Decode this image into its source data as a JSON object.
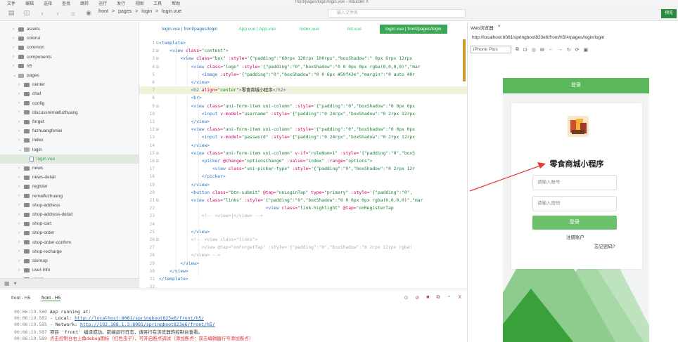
{
  "menubar": {
    "items": [
      "文件",
      "编辑",
      "选择",
      "查找",
      "跳转",
      "运行",
      "发行",
      "视图",
      "工具",
      "帮助"
    ],
    "window_title": "front/pages/login/login.vue - HBuilder X"
  },
  "toolbar": {
    "crumbs": [
      "front",
      ">",
      "pages",
      ">",
      "login",
      ">",
      "login.vue"
    ],
    "search_placeholder": "输入文件名",
    "preview_label": "预览"
  },
  "tree": {
    "items": [
      {
        "label": "assets",
        "type": "folder",
        "level": 1
      },
      {
        "label": "colorui",
        "type": "folder",
        "level": 1
      },
      {
        "label": "common",
        "type": "folder",
        "level": 1
      },
      {
        "label": "components",
        "type": "folder",
        "level": 1
      },
      {
        "label": "h5",
        "type": "folder",
        "level": 1
      },
      {
        "label": "pages",
        "type": "folder-open",
        "level": 1
      },
      {
        "label": "center",
        "type": "folder",
        "level": 2
      },
      {
        "label": "chat",
        "type": "folder",
        "level": 2
      },
      {
        "label": "config",
        "type": "folder",
        "level": 2
      },
      {
        "label": "discussremaifuzhuang",
        "type": "folder",
        "level": 2
      },
      {
        "label": "forget",
        "type": "folder",
        "level": 2
      },
      {
        "label": "fuzhuangfenlei",
        "type": "folder",
        "level": 2
      },
      {
        "label": "index",
        "type": "folder",
        "level": 2
      },
      {
        "label": "login",
        "type": "folder-open",
        "level": 2
      },
      {
        "label": "login.vue",
        "type": "file",
        "level": 3,
        "selected": true
      },
      {
        "label": "news",
        "type": "folder",
        "level": 2
      },
      {
        "label": "news-detail",
        "type": "folder",
        "level": 2
      },
      {
        "label": "register",
        "type": "folder",
        "level": 2
      },
      {
        "label": "remaifuzhuang",
        "type": "folder",
        "level": 2
      },
      {
        "label": "shop-address",
        "type": "folder",
        "level": 2
      },
      {
        "label": "shop-address-detail",
        "type": "folder",
        "level": 2
      },
      {
        "label": "shop-cart",
        "type": "folder",
        "level": 2
      },
      {
        "label": "shop-order",
        "type": "folder",
        "level": 2
      },
      {
        "label": "shop-order-confirm",
        "type": "folder",
        "level": 2
      },
      {
        "label": "shop-recharge",
        "type": "folder",
        "level": 2
      },
      {
        "label": "storeup",
        "type": "folder",
        "level": 2
      },
      {
        "label": "user-info",
        "type": "folder",
        "level": 2
      },
      {
        "label": "users",
        "type": "folder",
        "level": 2
      }
    ]
  },
  "editor": {
    "tabs": [
      {
        "label": "login.vue | front/pages/login",
        "active": false
      },
      {
        "label": "App.vue | App.vue",
        "active": false
      },
      {
        "label": "index.vue",
        "active": false
      },
      {
        "label": "list.vue",
        "active": false
      },
      {
        "label": "login.vue | front/pages/login",
        "active": true
      }
    ],
    "lines": [
      {
        "n": "1",
        "fold": "⊟",
        "html": "<span class='tag'>&lt;template&gt;</span>"
      },
      {
        "n": "2",
        "fold": "⊟",
        "html": "    <span class='tag'>&lt;view</span> <span class='attr'>class=</span><span class='str'>\"content\"</span><span class='tag'>&gt;</span>"
      },
      {
        "n": "3",
        "fold": "⊟",
        "html": "        <span class='tag'>&lt;view</span> <span class='attr'>class=</span><span class='str'>\"box\"</span> <span class='attr'>:style=</span><span class='str'>'{\"padding\":\"60rpx 120rpx 100rpx\",\"boxShadow\":\" 0px 6rpx 12rpx</span>"
      },
      {
        "n": "4",
        "fold": "⊟",
        "html": "            <span class='tag'>&lt;view</span> <span class='attr'>class=</span><span class='str'>\"logo\"</span> <span class='attr'>:style=</span><span class='str'>'{\"padding\":\"0\",\"boxShadow\":\"0 0 0px 0px rgba(0,0,0,0)\",\"mar</span>"
      },
      {
        "n": "5",
        "fold": "",
        "html": "                <span class='tag'>&lt;image</span> <span class='attr'>:style=</span><span class='str'>'{\"padding\":\"0\",\"boxShadow\":\"0 0 6px #59f43e\",\"margin\":\"0 auto 40r</span>"
      },
      {
        "n": "6",
        "fold": "",
        "html": "            <span class='tag'>&lt;/view&gt;</span>"
      },
      {
        "n": "7",
        "fold": "",
        "hl": true,
        "html": "            <span class='tag'>&lt;h2</span> <span class='attr'>align=</span><span class='str'>\"center\"</span><span class='tag'>&gt;</span><span class='txt'>零食商城小程序</span><span class='tag'>&lt;/h2&gt;</span>"
      },
      {
        "n": "8",
        "fold": "",
        "html": "            <span class='tag'>&lt;br&gt;</span>"
      },
      {
        "n": "9",
        "fold": "⊟",
        "html": "            <span class='tag'>&lt;view</span> <span class='attr'>class=</span><span class='str'>\"uni-form-item uni-column\"</span> <span class='attr'>:style=</span><span class='str'>'{\"padding\":\"0\",\"boxShadow\":\"0 0px 0px</span>"
      },
      {
        "n": "10",
        "fold": "",
        "html": "                <span class='tag'>&lt;input</span> <span class='attr'>v-model=</span><span class='str'>\"username\"</span> <span class='attr'>:style=</span><span class='str'>'{\"padding\":\"0 24rpx\",\"boxShadow\":\"0 2rpx 12rpx</span>"
      },
      {
        "n": "11",
        "fold": "",
        "html": "            <span class='tag'>&lt;/view&gt;</span>"
      },
      {
        "n": "12",
        "fold": "⊟",
        "html": "            <span class='tag'>&lt;view</span> <span class='attr'>class=</span><span class='str'>\"uni-form-item uni-column\"</span> <span class='attr'>:style=</span><span class='str'>'{\"padding\":\"0\",\"boxShadow\":\"0 0px 0px</span>"
      },
      {
        "n": "13",
        "fold": "",
        "html": "                <span class='tag'>&lt;input</span> <span class='attr'>v-model=</span><span class='str'>\"password\"</span> <span class='attr'>:style=</span><span class='str'>'{\"padding\":\"0 24rpx\",\"boxShadow\":\"0 2rpx 12rpx</span>"
      },
      {
        "n": "14",
        "fold": "",
        "html": "            <span class='tag'>&lt;/view&gt;</span>"
      },
      {
        "n": "15",
        "fold": "⊟",
        "html": "            <span class='tag'>&lt;view</span> <span class='attr'>class=</span><span class='str'>\"uni-form-item uni-column\"</span> <span class='attr'>v-if=</span><span class='str'>\"roleNum&gt;1\"</span> <span class='attr'>:style=</span><span class='str'>'{\"padding\":\"0\",\"boxS</span>"
      },
      {
        "n": "16",
        "fold": "⊟",
        "html": "                <span class='tag'>&lt;picker</span> <span class='attr'>@change=</span><span class='str'>\"optionsChange\"</span> <span class='attr'>:value=</span><span class='str'>\"index\"</span> <span class='attr'>:range=</span><span class='str'>\"options\"</span><span class='tag'>&gt;</span>"
      },
      {
        "n": "17",
        "fold": "",
        "html": "                    <span class='tag'>&lt;view</span> <span class='attr'>class=</span><span class='str'>\"uni-picker-type\"</span> <span class='attr'>:style=</span><span class='str'>'{\"padding\":\"0\",\"boxShadow\":\"0 2rpx 12r</span>"
      },
      {
        "n": "18",
        "fold": "",
        "html": "                <span class='tag'>&lt;/picker&gt;</span>"
      },
      {
        "n": "19",
        "fold": "",
        "html": "            <span class='tag'>&lt;/view&gt;</span>"
      },
      {
        "n": "20",
        "fold": "",
        "html": "            <span class='tag'>&lt;button</span> <span class='attr'>class=</span><span class='str'>\"btn-submit\"</span> <span class='attr'>@tap=</span><span class='str'>\"onLoginTap\"</span> <span class='attr'>type=</span><span class='str'>\"primary\"</span> <span class='attr'>:style=</span><span class='str'>'{\"padding\":\"0\",</span>"
      },
      {
        "n": "21",
        "fold": "⊟",
        "html": "            <span class='tag'>&lt;view</span> <span class='attr'>class=</span><span class='str'>\"links\"</span> <span class='attr'>:style=</span><span class='str'>'{\"padding\":\"0\",\"boxShadow\":\"0 0 0px 0px rgba(0,0,0,0)\",\"mar</span>"
      },
      {
        "n": "22",
        "fold": "",
        "html": "                                        <span class='tag'>&lt;view</span> <span class='attr'>class=</span><span class='str'>\"link-highlight\"</span> <span class='attr'>@tap=</span><span class='str'>\"onRegisterTap</span>"
      },
      {
        "n": "23",
        "fold": "",
        "html": "                <span class='cmt'>&lt;!-- &lt;view&gt;|&lt;/view&gt; --&gt;</span>"
      },
      {
        "n": "24",
        "fold": "",
        "html": ""
      },
      {
        "n": "25",
        "fold": "",
        "html": "            <span class='tag'>&lt;/view&gt;</span>"
      },
      {
        "n": "26",
        "fold": "⊟",
        "html": "            <span class='cmt'>&lt;!-- &lt;view class=\"links\"&gt;</span>"
      },
      {
        "n": "27",
        "fold": "",
        "html": "                <span class='cmt'>&lt;view @tap=\"onForgetTap\" :style='{\"padding\":\"0\",\"boxShadow\":\"0 2rpx 12rpx rgba(</span>"
      },
      {
        "n": "28",
        "fold": "",
        "html": "            <span class='cmt'>&lt;/view&gt; --&gt;</span>"
      },
      {
        "n": "29",
        "fold": "",
        "html": "        <span class='tag'>&lt;/view&gt;</span>"
      },
      {
        "n": "30",
        "fold": "",
        "html": "    <span class='tag'>&lt;/view&gt;</span>"
      },
      {
        "n": "31",
        "fold": "",
        "html": "<span class='tag'>&lt;/template&gt;</span>"
      },
      {
        "n": "32",
        "fold": "",
        "html": ""
      }
    ]
  },
  "console": {
    "tabs": [
      {
        "label": "front - H5",
        "active": false
      },
      {
        "label": "front - H5",
        "active": true
      }
    ],
    "icons": [
      "⊙",
      "⊘",
      "■",
      "⧉",
      "⌃",
      "X"
    ],
    "lines": [
      {
        "time": "00:06:19.580",
        "text": "  App running at:",
        "link": ""
      },
      {
        "time": "00:06:19.582",
        "text": "  - Local:   ",
        "link": "http://localhost:8081/springboot823e6/front/h5/"
      },
      {
        "time": "00:06:19.585",
        "text": "  - Network: ",
        "link": "http://192.168.1.3:8081/springboot823e6/front/h5/"
      },
      {
        "time": "00:06:19.587",
        "text": " 项目 'front' 编译成功。前端运行日志，请另行在浏览器的控制台查看。",
        "link": ""
      },
      {
        "time": "00:06:19.589",
        "text": " 点击控制台右上角debug图标（红色虫子），可开启断点调试（添加断点：双击编辑器行号添加断点）",
        "link": "",
        "red": true
      }
    ]
  },
  "browser": {
    "title": "Web浏览器",
    "close": "×",
    "url": "http://localhost:8081/springboot823e6/front/h5/#/pages/login/login",
    "device": "iPhone Plus",
    "tool_icons": [
      "⧉",
      "⊡",
      "◎",
      "⊞",
      "←",
      "→",
      "↻",
      "⟳",
      "▣"
    ],
    "app": {
      "nav_title": "登录",
      "title": "零食商城小程序",
      "username_placeholder": "请输入账号",
      "password_placeholder": "请输入密码",
      "login_label": "登录",
      "register_label": "注册账户",
      "forgot_label": "忘记密码?"
    }
  },
  "colors": {
    "accent": "#3aa757",
    "app_green": "#5cb85c",
    "arrow": "#e53935"
  }
}
